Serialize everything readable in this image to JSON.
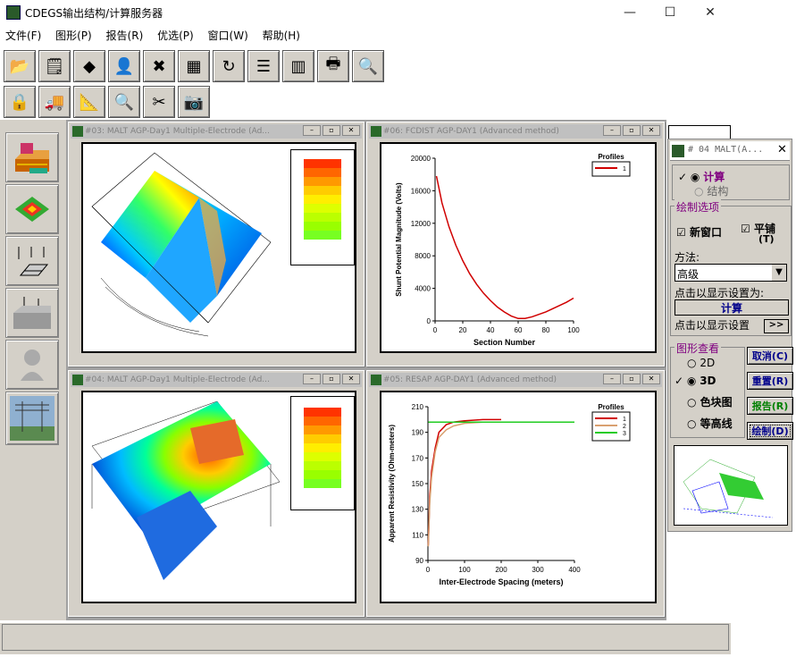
{
  "window": {
    "title": "CDEGS输出结构/计算服务器",
    "min": "—",
    "max": "☐",
    "close": "✕"
  },
  "menu": [
    "文件(F)",
    "图形(P)",
    "报告(R)",
    "优选(P)",
    "窗口(W)",
    "帮助(H)"
  ],
  "toolbar1": [
    {
      "icon": "folder-open-icon",
      "glyph": "📂"
    },
    {
      "icon": "edit-properties-icon",
      "glyph": "🗒"
    },
    {
      "icon": "shapes-icon",
      "glyph": "◆"
    },
    {
      "icon": "person-icon",
      "glyph": "👤"
    },
    {
      "icon": "delete-icon",
      "glyph": "✖"
    },
    {
      "icon": "chart-frame-icon",
      "glyph": "▦"
    },
    {
      "icon": "refresh-icon",
      "glyph": "↻"
    },
    {
      "icon": "stack-icon",
      "glyph": "☰"
    },
    {
      "icon": "columns-icon",
      "glyph": "▥"
    },
    {
      "icon": "printer-icon",
      "glyph": "🖶"
    },
    {
      "icon": "print-preview-icon",
      "glyph": "🔍"
    }
  ],
  "toolbar2": [
    {
      "icon": "lock-icon",
      "glyph": "🔒"
    },
    {
      "icon": "truck-icon",
      "glyph": "🚚"
    },
    {
      "icon": "ruler-icon",
      "glyph": "📐"
    },
    {
      "icon": "magnifier-icon",
      "glyph": "🔍"
    },
    {
      "icon": "scissors-icon",
      "glyph": "✂"
    },
    {
      "icon": "camera-icon",
      "glyph": "📷"
    }
  ],
  "leftpanel": [
    {
      "icon": "grid-3d-icon"
    },
    {
      "icon": "surface-plot-icon"
    },
    {
      "icon": "electrode-icon"
    },
    {
      "icon": "soil-structure-icon"
    },
    {
      "icon": "figure-icon"
    },
    {
      "icon": "tower-icon"
    }
  ],
  "windows": {
    "w1": {
      "title": "#03: MALT AGP-Day1  Multiple-Electrode (Ad..."
    },
    "w2": {
      "title": "#06: FCDIST AGP-DAY1  (Advanced method)"
    },
    "w3": {
      "title": "#04: MALT AGP-Day1  Multiple-Electrode (Ad..."
    },
    "w4": {
      "title": "#05: RESAP AGP-DAY1  (Advanced method)"
    }
  },
  "colors": {
    "grey": "#d4d0c8",
    "red_line": "#d00000",
    "green_line": "#22cc22",
    "tan_line": "#d9a070",
    "purple": "#800080"
  },
  "chart_data": [
    {
      "type": "line",
      "title": "",
      "xlabel": "Section Number",
      "ylabel": "Shunt Potential Magnitude (Volts)",
      "xlim": [
        0,
        100
      ],
      "ylim": [
        0,
        20000
      ],
      "xticks": [
        "0",
        "20",
        "40",
        "60",
        "80",
        "100"
      ],
      "yticks": [
        "0",
        "4000",
        "8000",
        "12000",
        "16000",
        "20000"
      ],
      "legend_title": "Profiles",
      "legend_position": "top-right",
      "series": [
        {
          "name": "1",
          "x": [
            1,
            5,
            10,
            15,
            20,
            25,
            30,
            35,
            40,
            45,
            50,
            55,
            60,
            65,
            70,
            75,
            80,
            85,
            90,
            95,
            100
          ],
          "y": [
            17800,
            14500,
            11600,
            9300,
            7400,
            5800,
            4500,
            3400,
            2500,
            1700,
            1100,
            600,
            300,
            300,
            500,
            800,
            1100,
            1500,
            1900,
            2300,
            2800
          ]
        }
      ]
    },
    {
      "type": "line",
      "title": "",
      "xlabel": "Inter-Electrode Spacing (meters)",
      "ylabel": "Apparent Resistivity (Ohm-meters)",
      "xlim": [
        0,
        400
      ],
      "ylim": [
        90,
        210
      ],
      "xticks": [
        "0",
        "100",
        "200",
        "300",
        "400"
      ],
      "yticks": [
        "90",
        "110",
        "130",
        "150",
        "170",
        "190",
        "210"
      ],
      "legend_title": "Profiles",
      "legend_position": "top-right",
      "series": [
        {
          "name": "1",
          "x": [
            1,
            5,
            10,
            20,
            30,
            50,
            70,
            100,
            150,
            200
          ],
          "y": [
            102,
            140,
            160,
            178,
            190,
            196,
            198,
            199,
            200,
            200
          ]
        },
        {
          "name": "2",
          "x": [
            1,
            5,
            10,
            20,
            30,
            50,
            70,
            100,
            150,
            200,
            300,
            400
          ],
          "y": [
            101,
            135,
            155,
            175,
            186,
            192,
            195,
            197,
            198,
            198,
            198,
            198
          ]
        },
        {
          "name": "3",
          "x": [
            1,
            5,
            10,
            20,
            30,
            50,
            100,
            200,
            300,
            400
          ],
          "y": [
            198,
            198,
            198,
            198,
            198,
            198,
            198,
            198,
            198,
            198
          ]
        }
      ]
    }
  ],
  "props": {
    "title": "# 04  MALT(A...",
    "close": "✕",
    "calc_label": "计算",
    "struct_label": "结构",
    "draw_options": "绘制选项",
    "new_window": "新窗口",
    "tile": "平铺",
    "tile_hotkey": "(T)",
    "method_label": "方法:",
    "method_value": "高级",
    "click_show": "点击以显示设置为:",
    "calc_button": "计算",
    "click_show2": "点击以显示设置",
    "more_button": ">>",
    "view_label": "图形查看",
    "view_2d": "2D",
    "view_3d": "3D",
    "view_color": "色块图",
    "view_contour": "等高线",
    "cancel": "取消(C)",
    "reset": "重置(R)",
    "report": "报告(R)",
    "draw": "绘制(D)"
  }
}
